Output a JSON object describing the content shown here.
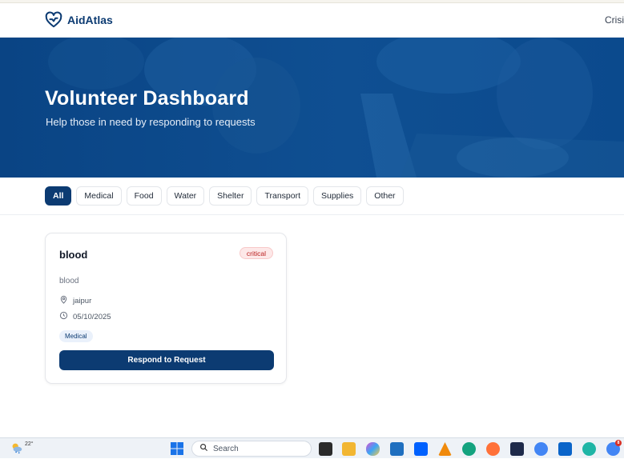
{
  "brand": {
    "name": "AidAtlas",
    "logo_icon": "heart-hand-icon",
    "color": "#0c3b72"
  },
  "nav": {
    "link_label": "Crisis"
  },
  "hero": {
    "title": "Volunteer Dashboard",
    "subtitle": "Help those in need by responding to requests"
  },
  "filters": [
    {
      "label": "All",
      "active": true
    },
    {
      "label": "Medical",
      "active": false
    },
    {
      "label": "Food",
      "active": false
    },
    {
      "label": "Water",
      "active": false
    },
    {
      "label": "Shelter",
      "active": false
    },
    {
      "label": "Transport",
      "active": false
    },
    {
      "label": "Supplies",
      "active": false
    },
    {
      "label": "Other",
      "active": false
    }
  ],
  "requests": [
    {
      "title": "blood",
      "priority": "critical",
      "description": "blood",
      "location": "jaipur",
      "date": "05/10/2025",
      "category": "Medical",
      "action_label": "Respond to Request"
    }
  ],
  "taskbar": {
    "temperature": "22°",
    "search_placeholder": "Search",
    "notification_count": "8"
  },
  "colors": {
    "primary": "#0c3b72",
    "critical_bg": "#fde8e8",
    "critical_text": "#b91c1c"
  }
}
